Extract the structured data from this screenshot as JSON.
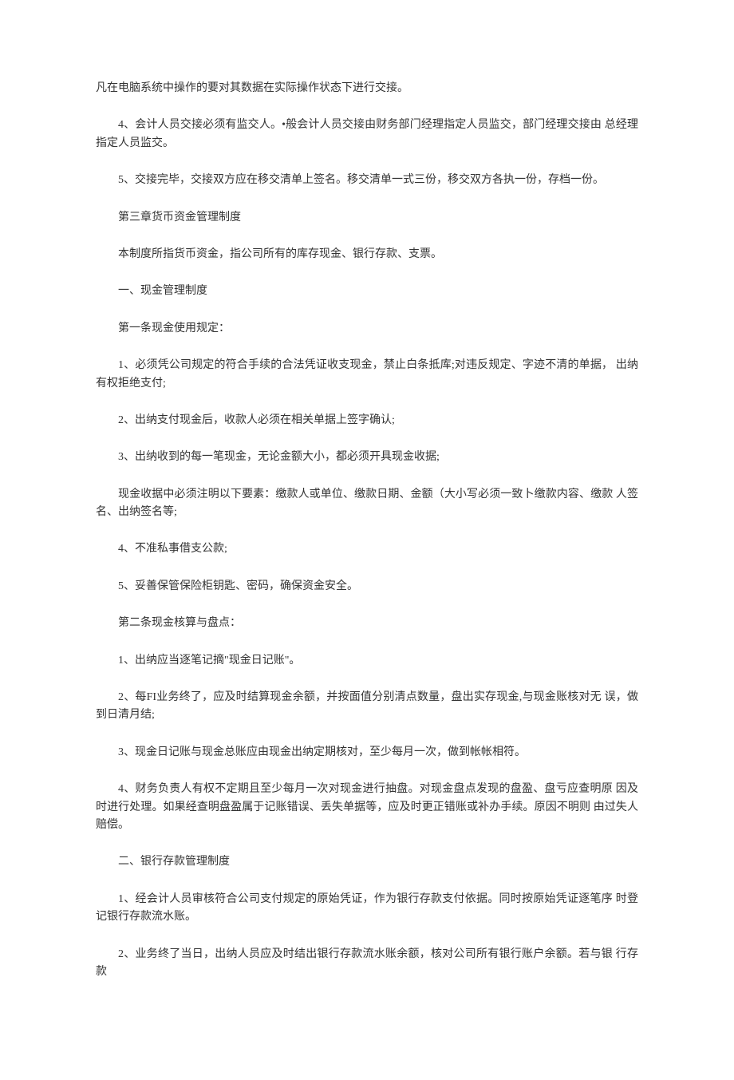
{
  "paragraphs": {
    "p1": "凡在电脑系统中操作的要对其数据在实际操作状态下进行交接。",
    "p2": "4、会计人员交接必须有监交人。•般会计人员交接由财务部门经理指定人员监交，部门经理交接由 总经理指定人员监交。",
    "p3": "5、交接完毕，交接双方应在移交清单上签名。移交清单一式三份，移交双方各执一份，存档一份。",
    "p4": "第三章货币资金管理制度",
    "p5": "本制度所指货币资金，指公司所有的库存现金、银行存款、支票。",
    "p6": "一、现金管理制度",
    "p7": "第一条现金使用规定：",
    "p8": "1、必须凭公司规定的符合手续的合法凭证收支现金，禁止白条抵库;对违反规定、字迹不清的单据， 出纳有权拒绝支付;",
    "p9": "2、出纳支付现金后，收款人必须在相关单据上签字确认;",
    "p10": "3、出纳收到的每一笔现金，无论金额大小，都必须开具现金收据;",
    "p11": "现金收据中必须注明以下要素：缴款人或单位、缴款日期、金额（大小写必须一致卜缴款内容、缴款 人签名、出纳签名等;",
    "p12": "4、不准私事借支公款;",
    "p13": "5、妥善保管保险柜钥匙、密码，确保资金安全。",
    "p14": "第二条现金核算与盘点：",
    "p15": "1、出纳应当逐笔记摘\"现金日记账\"。",
    "p16": "2、每FI业务终了，应及时结算现金余额，并按面值分别清点数量，盘出实存现金,与现金账核对无 误，做到日清月结;",
    "p17": "3、现金日记账与现金总账应由现金出纳定期核对，至少每月一次，做到帐帐相符。",
    "p18": "4、财务负责人有权不定期且至少每月一次对现金进行抽盘。对现金盘点发现的盘盈、盘亏应查明原 因及时进行处理。如果经查明盘盈属于记账错误、丢失单据等，应及时更正错账或补办手续。原因不明则 由过失人赔偿。",
    "p19": "二、银行存款管理制度",
    "p20": "1、经会计人员审核符合公司支付规定的原始凭证，作为银行存款支付依据。同时按原始凭证逐笔序 时登记银行存款流水账。",
    "p21": "2、业务终了当日，出纳人员应及时结出银行存款流水账余额，核对公司所有银行账户余额。若与银 行存款"
  }
}
